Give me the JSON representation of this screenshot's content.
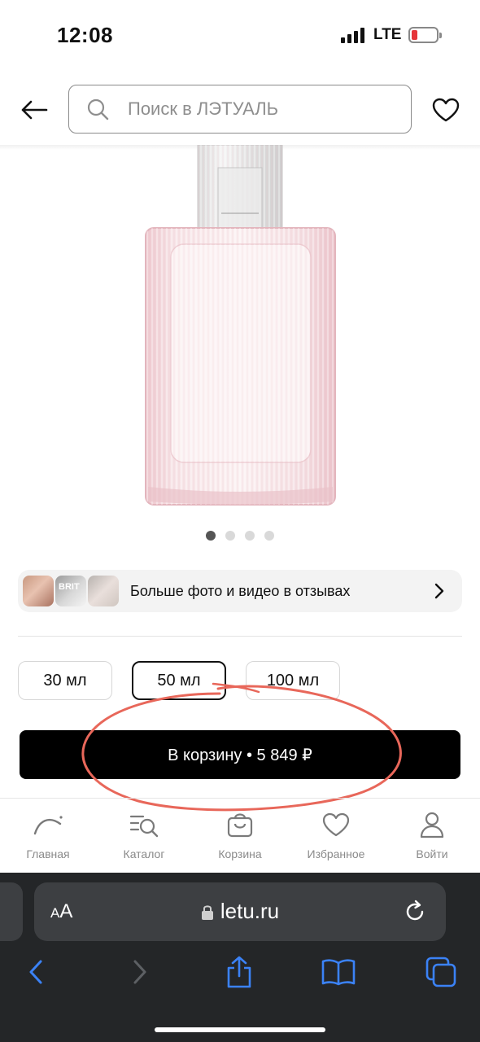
{
  "status_bar": {
    "time": "12:08",
    "network": "LTE",
    "battery_color": "#e5353a"
  },
  "search": {
    "placeholder": "Поиск в ЛЭТУАЛЬ"
  },
  "gallery": {
    "total_slides": 4,
    "active_slide": 1
  },
  "reviews_banner": {
    "thumb2_text": "BRIT",
    "label": "Больше фото и видео в отзывах"
  },
  "volumes": [
    {
      "label": "30 мл",
      "selected": false
    },
    {
      "label": "50 мл",
      "selected": true
    },
    {
      "label": "100 мл",
      "selected": false
    }
  ],
  "cart_button": {
    "label": "В корзину • 5 849 ₽"
  },
  "bottom_nav": [
    {
      "label": "Главная",
      "icon": "home-logo-icon"
    },
    {
      "label": "Каталог",
      "icon": "catalog-search-icon"
    },
    {
      "label": "Корзина",
      "icon": "cart-bag-icon"
    },
    {
      "label": "Избранное",
      "icon": "heart-icon"
    },
    {
      "label": "Войти",
      "icon": "user-icon"
    }
  ],
  "browser": {
    "text_size_label_small": "A",
    "text_size_label_large": "A",
    "url": "letu.ru"
  },
  "colors": {
    "accent": "#000000",
    "annotation": "#e8675a",
    "browser_blue": "#3b82f6"
  }
}
